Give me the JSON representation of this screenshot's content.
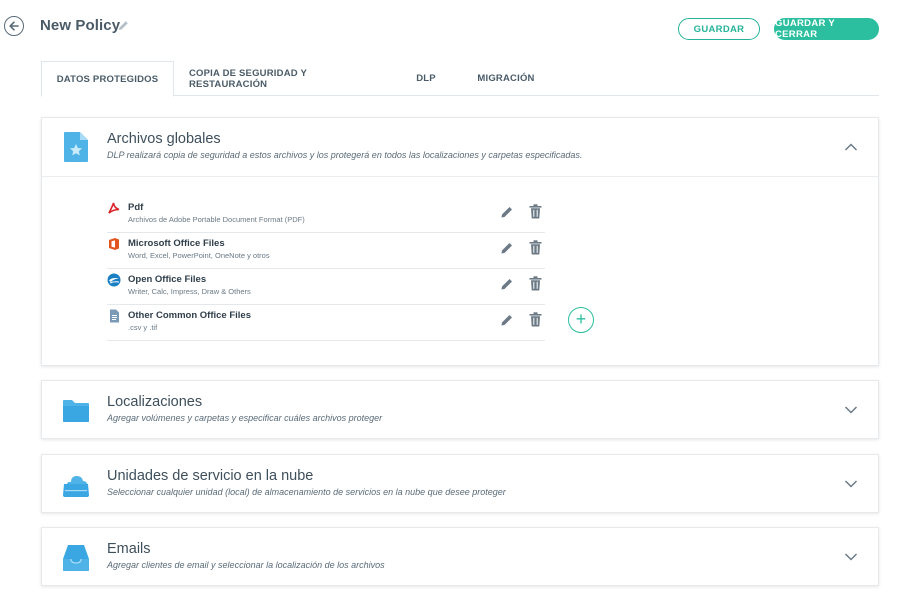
{
  "header": {
    "title": "New Policy",
    "save_label": "GUARDAR",
    "save_close_label": "GUARDAR Y CERRAR"
  },
  "tabs": [
    {
      "label": "DATOS PROTEGIDOS",
      "active": true
    },
    {
      "label": "COPIA DE SEGURIDAD Y RESTAURACIÓN",
      "active": false
    },
    {
      "label": "DLP",
      "active": false
    },
    {
      "label": "MIGRACIÓN",
      "active": false
    }
  ],
  "sections": [
    {
      "title": "Archivos globales",
      "subtitle": "DLP realizará copia de seguridad a estos archivos y los protegerá en todos las localizaciones y carpetas especificadas.",
      "icon": "file-star-icon",
      "expanded": true,
      "files": [
        {
          "name": "Pdf",
          "description": "Archivos de Adobe Portable Document Format (PDF)",
          "icon": "pdf-icon"
        },
        {
          "name": "Microsoft Office Files",
          "description": "Word, Excel, PowerPoint, OneNote y otros",
          "icon": "ms-office-icon"
        },
        {
          "name": "Open Office Files",
          "description": "Writer, Calc, Impress, Draw & Others",
          "icon": "open-office-icon"
        },
        {
          "name": "Other Common Office Files",
          "description": ".csv y .tif",
          "icon": "document-icon"
        }
      ]
    },
    {
      "title": "Localizaciones",
      "subtitle": "Agregar volúmenes y carpetas y especificar cuáles archivos proteger",
      "icon": "folder-icon",
      "expanded": false
    },
    {
      "title": "Unidades de servicio en la nube",
      "subtitle": "Seleccionar cualquier unidad (local) de almacenamiento de servicios en la nube que desee proteger",
      "icon": "cloud-drive-icon",
      "expanded": false
    },
    {
      "title": "Emails",
      "subtitle": "Agregar clientes de email y seleccionar la localización de los archivos",
      "icon": "inbox-icon",
      "expanded": false
    }
  ],
  "colors": {
    "accent": "#2bbf9f",
    "icon_blue": "#4fb3e8",
    "text": "#3e4f5c"
  }
}
